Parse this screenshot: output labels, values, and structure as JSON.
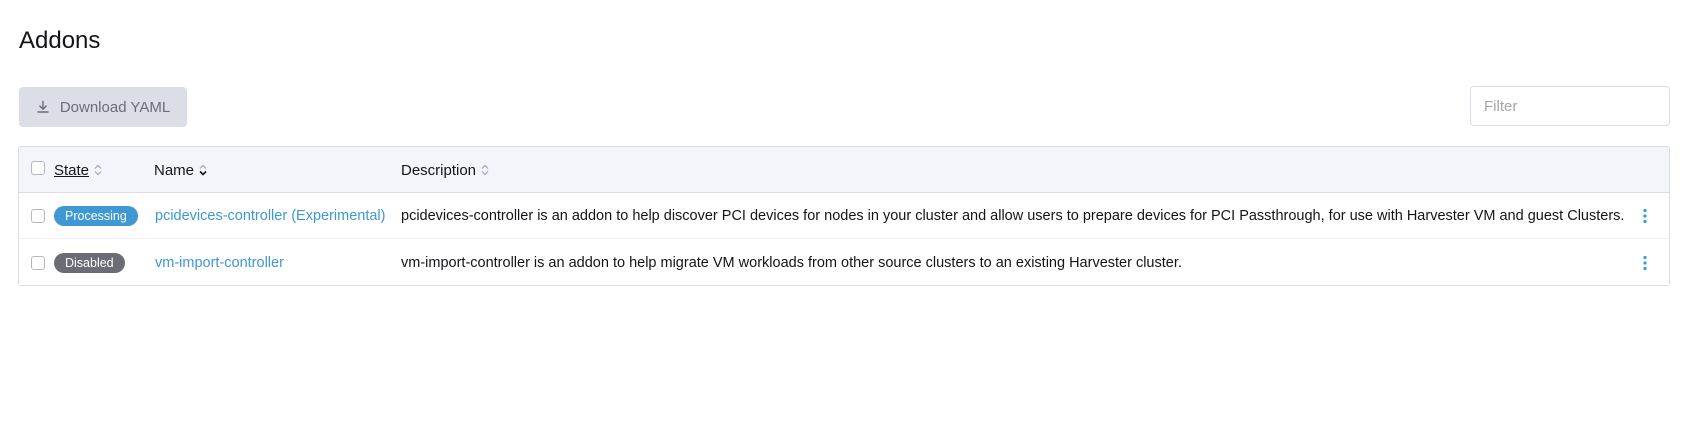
{
  "page": {
    "title": "Addons"
  },
  "toolbar": {
    "download_label": "Download YAML"
  },
  "filter": {
    "placeholder": "Filter",
    "value": ""
  },
  "table": {
    "columns": {
      "state": "State",
      "name": "Name",
      "description": "Description"
    },
    "rows": [
      {
        "state": "Processing",
        "name": "pcidevices-controller (Experimental)",
        "description": "pcidevices-controller is an addon to help discover PCI devices for nodes in your cluster and allow users to prepare devices for PCI Passthrough, for use with Harvester VM and guest Clusters."
      },
      {
        "state": "Disabled",
        "name": "vm-import-controller",
        "description": "vm-import-controller is an addon to help migrate VM workloads from other source clusters to an existing Harvester cluster."
      }
    ]
  },
  "icons": {
    "download": "download-icon",
    "sort": "sort-icon",
    "sort_active": "sort-down-icon",
    "actions": "kebab-menu-icon"
  },
  "colors": {
    "link": "#3d98d3",
    "badge_processing": "#3d98d3",
    "badge_disabled": "#6c6c76",
    "button_disabled_bg": "#dcdee7",
    "table_header_bg": "#f4f5fa"
  }
}
